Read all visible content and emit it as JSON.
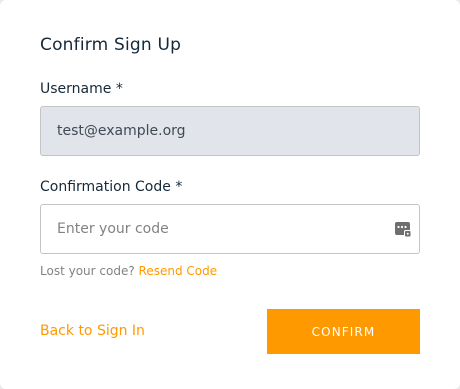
{
  "form": {
    "title": "Confirm Sign Up",
    "username_label": "Username *",
    "username_value": "test@example.org",
    "code_label": "Confirmation Code *",
    "code_placeholder": "Enter your code",
    "code_value": "",
    "lost_code_text": "Lost your code?",
    "resend_link": "Resend Code",
    "back_link": "Back to Sign In",
    "confirm_button": "CONFIRM"
  },
  "icons": {
    "code_field_icon": "key-dots-icon"
  },
  "colors": {
    "accent": "#ff9900",
    "text": "#152939",
    "muted": "#828282",
    "disabled_field_bg": "#e1e4ea"
  }
}
